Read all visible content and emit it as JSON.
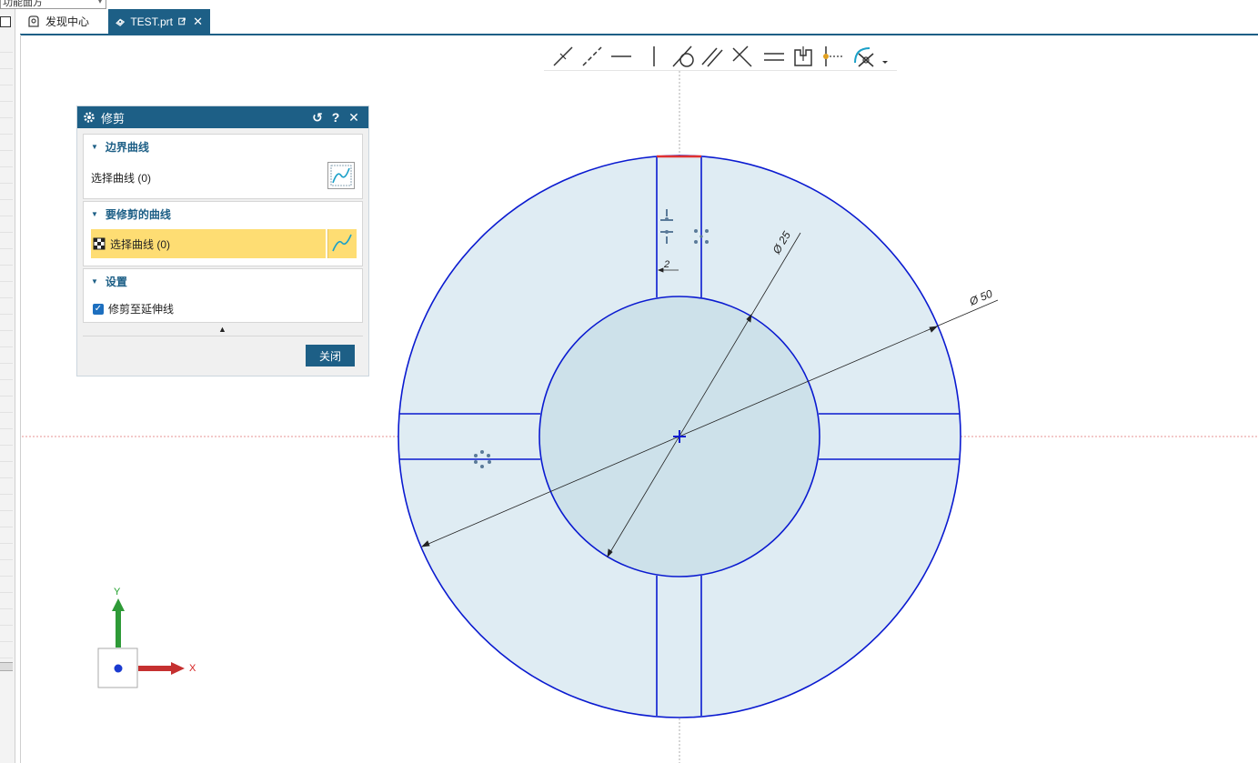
{
  "top_box": {
    "text": "功能面方"
  },
  "tabs": [
    {
      "label": "发现中心",
      "icon": "discovery-icon"
    },
    {
      "label": "TEST.prt",
      "icon": "part-icon",
      "active": true
    }
  ],
  "toolbar": {
    "icons": [
      "perpendicular-dim-icon",
      "angle-dim-icon",
      "horizontal-icon",
      "vertical-icon",
      "tangent-icon",
      "parallel-icon",
      "perpendicular-icon",
      "equal-length-icon",
      "fixed-icon",
      "point-on-curve-icon",
      "trim-icon",
      "more-dropdown-icon"
    ]
  },
  "dialog": {
    "title": "修剪",
    "header_buttons": {
      "reset": "↺",
      "help": "?",
      "close": "✕"
    },
    "boundary": {
      "heading": "边界曲线",
      "select_label": "选择曲线 (0)"
    },
    "trim_curve": {
      "heading": "要修剪的曲线",
      "select_label": "选择曲线 (0)"
    },
    "settings": {
      "heading": "设置",
      "checkbox_label": "修剪至延伸线",
      "checked": true
    },
    "close_label": "关闭"
  },
  "dimensions": {
    "inner": "Ø 25",
    "outer": "Ø 50",
    "slot": "2"
  },
  "triad": {
    "x_label": "X",
    "y_label": "Y"
  },
  "colors": {
    "accent": "#1d5f86",
    "highlight": "#fedd73",
    "curve": "#0a1ad0",
    "fill": "#dfecf3",
    "inner_fill": "#cde1ea",
    "selected_arc": "#e03030"
  }
}
